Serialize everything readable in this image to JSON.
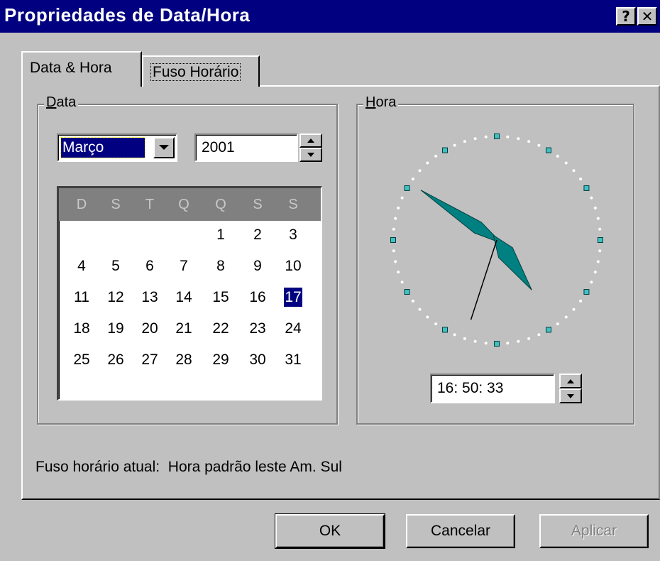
{
  "window": {
    "title": "Propriedades de Data/Hora",
    "help_button": "?",
    "close_button": "✕"
  },
  "tabs": [
    {
      "label": "Data & Hora",
      "active": true
    },
    {
      "label": "Fuso Horário",
      "active": false
    }
  ],
  "date_group": {
    "label_underlined": "D",
    "label_rest": "ata",
    "month": "Março",
    "year": "2001",
    "weekday_headers": [
      "D",
      "S",
      "T",
      "Q",
      "Q",
      "S",
      "S"
    ],
    "weeks": [
      [
        "",
        "",
        "",
        "",
        "1",
        "2",
        "3"
      ],
      [
        "4",
        "5",
        "6",
        "7",
        "8",
        "9",
        "10"
      ],
      [
        "11",
        "12",
        "13",
        "14",
        "15",
        "16",
        "17"
      ],
      [
        "18",
        "19",
        "20",
        "21",
        "22",
        "23",
        "24"
      ],
      [
        "25",
        "26",
        "27",
        "28",
        "29",
        "30",
        "31"
      ]
    ],
    "selected_day": "17"
  },
  "time_group": {
    "label_underlined": "H",
    "label_rest": "ora",
    "time": "16: 50: 33",
    "clock": {
      "hour": 16,
      "minute": 50,
      "second": 33
    }
  },
  "timezone_line": {
    "label": "Fuso horário atual:",
    "value": "Hora padrão leste Am. Sul"
  },
  "buttons": {
    "ok": "OK",
    "cancel": "Cancelar",
    "apply": "Aplicar"
  },
  "colors": {
    "title_bar": "#000080",
    "face": "#c0c0c0",
    "selection": "#000080",
    "clock_hand": "#008080"
  }
}
